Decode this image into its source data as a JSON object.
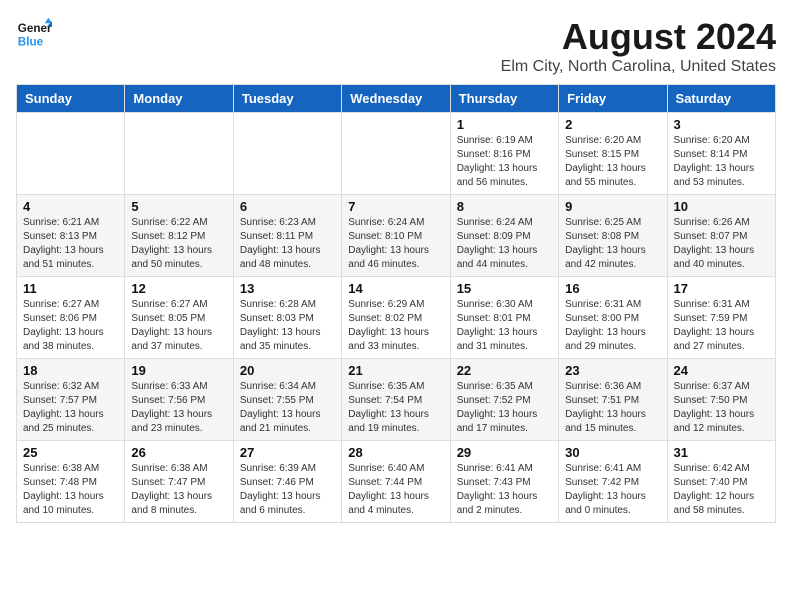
{
  "logo": {
    "line1": "General",
    "line2": "Blue"
  },
  "title": "August 2024",
  "subtitle": "Elm City, North Carolina, United States",
  "weekdays": [
    "Sunday",
    "Monday",
    "Tuesday",
    "Wednesday",
    "Thursday",
    "Friday",
    "Saturday"
  ],
  "weeks": [
    [
      {
        "day": "",
        "sunrise": "",
        "sunset": "",
        "daylight": ""
      },
      {
        "day": "",
        "sunrise": "",
        "sunset": "",
        "daylight": ""
      },
      {
        "day": "",
        "sunrise": "",
        "sunset": "",
        "daylight": ""
      },
      {
        "day": "",
        "sunrise": "",
        "sunset": "",
        "daylight": ""
      },
      {
        "day": "1",
        "sunrise": "Sunrise: 6:19 AM",
        "sunset": "Sunset: 8:16 PM",
        "daylight": "Daylight: 13 hours and 56 minutes."
      },
      {
        "day": "2",
        "sunrise": "Sunrise: 6:20 AM",
        "sunset": "Sunset: 8:15 PM",
        "daylight": "Daylight: 13 hours and 55 minutes."
      },
      {
        "day": "3",
        "sunrise": "Sunrise: 6:20 AM",
        "sunset": "Sunset: 8:14 PM",
        "daylight": "Daylight: 13 hours and 53 minutes."
      }
    ],
    [
      {
        "day": "4",
        "sunrise": "Sunrise: 6:21 AM",
        "sunset": "Sunset: 8:13 PM",
        "daylight": "Daylight: 13 hours and 51 minutes."
      },
      {
        "day": "5",
        "sunrise": "Sunrise: 6:22 AM",
        "sunset": "Sunset: 8:12 PM",
        "daylight": "Daylight: 13 hours and 50 minutes."
      },
      {
        "day": "6",
        "sunrise": "Sunrise: 6:23 AM",
        "sunset": "Sunset: 8:11 PM",
        "daylight": "Daylight: 13 hours and 48 minutes."
      },
      {
        "day": "7",
        "sunrise": "Sunrise: 6:24 AM",
        "sunset": "Sunset: 8:10 PM",
        "daylight": "Daylight: 13 hours and 46 minutes."
      },
      {
        "day": "8",
        "sunrise": "Sunrise: 6:24 AM",
        "sunset": "Sunset: 8:09 PM",
        "daylight": "Daylight: 13 hours and 44 minutes."
      },
      {
        "day": "9",
        "sunrise": "Sunrise: 6:25 AM",
        "sunset": "Sunset: 8:08 PM",
        "daylight": "Daylight: 13 hours and 42 minutes."
      },
      {
        "day": "10",
        "sunrise": "Sunrise: 6:26 AM",
        "sunset": "Sunset: 8:07 PM",
        "daylight": "Daylight: 13 hours and 40 minutes."
      }
    ],
    [
      {
        "day": "11",
        "sunrise": "Sunrise: 6:27 AM",
        "sunset": "Sunset: 8:06 PM",
        "daylight": "Daylight: 13 hours and 38 minutes."
      },
      {
        "day": "12",
        "sunrise": "Sunrise: 6:27 AM",
        "sunset": "Sunset: 8:05 PM",
        "daylight": "Daylight: 13 hours and 37 minutes."
      },
      {
        "day": "13",
        "sunrise": "Sunrise: 6:28 AM",
        "sunset": "Sunset: 8:03 PM",
        "daylight": "Daylight: 13 hours and 35 minutes."
      },
      {
        "day": "14",
        "sunrise": "Sunrise: 6:29 AM",
        "sunset": "Sunset: 8:02 PM",
        "daylight": "Daylight: 13 hours and 33 minutes."
      },
      {
        "day": "15",
        "sunrise": "Sunrise: 6:30 AM",
        "sunset": "Sunset: 8:01 PM",
        "daylight": "Daylight: 13 hours and 31 minutes."
      },
      {
        "day": "16",
        "sunrise": "Sunrise: 6:31 AM",
        "sunset": "Sunset: 8:00 PM",
        "daylight": "Daylight: 13 hours and 29 minutes."
      },
      {
        "day": "17",
        "sunrise": "Sunrise: 6:31 AM",
        "sunset": "Sunset: 7:59 PM",
        "daylight": "Daylight: 13 hours and 27 minutes."
      }
    ],
    [
      {
        "day": "18",
        "sunrise": "Sunrise: 6:32 AM",
        "sunset": "Sunset: 7:57 PM",
        "daylight": "Daylight: 13 hours and 25 minutes."
      },
      {
        "day": "19",
        "sunrise": "Sunrise: 6:33 AM",
        "sunset": "Sunset: 7:56 PM",
        "daylight": "Daylight: 13 hours and 23 minutes."
      },
      {
        "day": "20",
        "sunrise": "Sunrise: 6:34 AM",
        "sunset": "Sunset: 7:55 PM",
        "daylight": "Daylight: 13 hours and 21 minutes."
      },
      {
        "day": "21",
        "sunrise": "Sunrise: 6:35 AM",
        "sunset": "Sunset: 7:54 PM",
        "daylight": "Daylight: 13 hours and 19 minutes."
      },
      {
        "day": "22",
        "sunrise": "Sunrise: 6:35 AM",
        "sunset": "Sunset: 7:52 PM",
        "daylight": "Daylight: 13 hours and 17 minutes."
      },
      {
        "day": "23",
        "sunrise": "Sunrise: 6:36 AM",
        "sunset": "Sunset: 7:51 PM",
        "daylight": "Daylight: 13 hours and 15 minutes."
      },
      {
        "day": "24",
        "sunrise": "Sunrise: 6:37 AM",
        "sunset": "Sunset: 7:50 PM",
        "daylight": "Daylight: 13 hours and 12 minutes."
      }
    ],
    [
      {
        "day": "25",
        "sunrise": "Sunrise: 6:38 AM",
        "sunset": "Sunset: 7:48 PM",
        "daylight": "Daylight: 13 hours and 10 minutes."
      },
      {
        "day": "26",
        "sunrise": "Sunrise: 6:38 AM",
        "sunset": "Sunset: 7:47 PM",
        "daylight": "Daylight: 13 hours and 8 minutes."
      },
      {
        "day": "27",
        "sunrise": "Sunrise: 6:39 AM",
        "sunset": "Sunset: 7:46 PM",
        "daylight": "Daylight: 13 hours and 6 minutes."
      },
      {
        "day": "28",
        "sunrise": "Sunrise: 6:40 AM",
        "sunset": "Sunset: 7:44 PM",
        "daylight": "Daylight: 13 hours and 4 minutes."
      },
      {
        "day": "29",
        "sunrise": "Sunrise: 6:41 AM",
        "sunset": "Sunset: 7:43 PM",
        "daylight": "Daylight: 13 hours and 2 minutes."
      },
      {
        "day": "30",
        "sunrise": "Sunrise: 6:41 AM",
        "sunset": "Sunset: 7:42 PM",
        "daylight": "Daylight: 13 hours and 0 minutes."
      },
      {
        "day": "31",
        "sunrise": "Sunrise: 6:42 AM",
        "sunset": "Sunset: 7:40 PM",
        "daylight": "Daylight: 12 hours and 58 minutes."
      }
    ]
  ]
}
